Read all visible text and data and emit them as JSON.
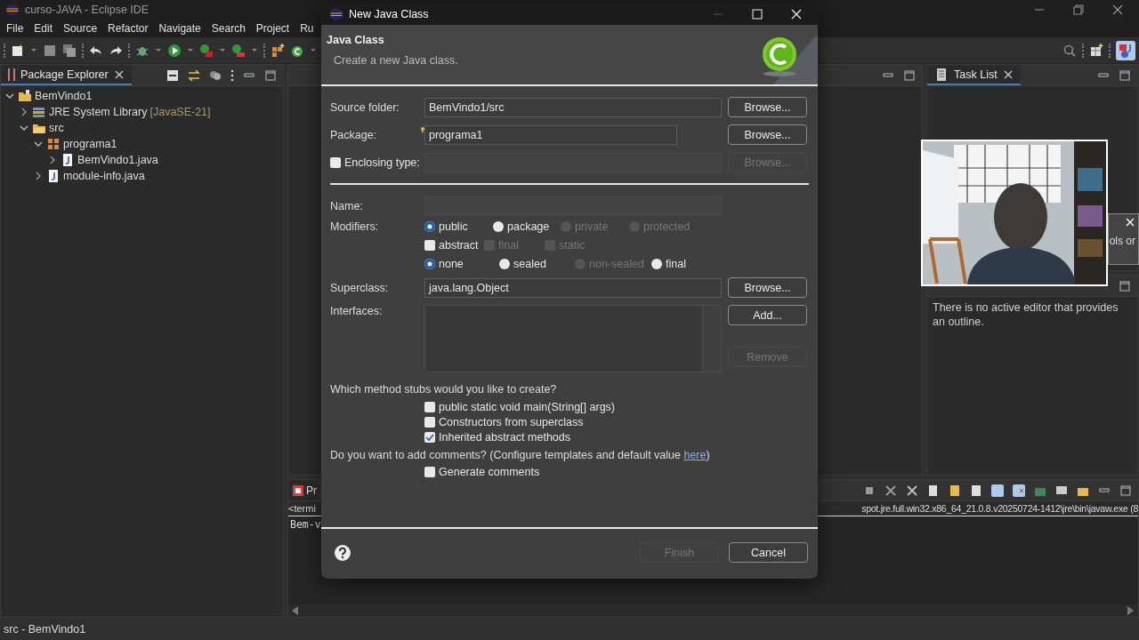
{
  "window": {
    "title": "curso-JAVA - Eclipse IDE"
  },
  "menu": [
    "File",
    "Edit",
    "Source",
    "Refactor",
    "Navigate",
    "Search",
    "Project",
    "Ru"
  ],
  "package_explorer": {
    "title": "Package Explorer",
    "tree": [
      {
        "label": "BemVindo1",
        "kind": "project",
        "expanded": true,
        "children": [
          {
            "label": "JRE System Library",
            "suffix": "[JavaSE-21]",
            "kind": "library",
            "expanded": false
          },
          {
            "label": "src",
            "kind": "folder",
            "expanded": true,
            "children": [
              {
                "label": "programa1",
                "kind": "package",
                "expanded": true,
                "children": [
                  {
                    "label": "BemVindo1.java",
                    "kind": "java",
                    "expanded": false
                  }
                ]
              },
              {
                "label": "module-info.java",
                "kind": "java",
                "expanded": false
              }
            ]
          }
        ]
      }
    ]
  },
  "task_list": {
    "title": "Task List"
  },
  "notification": {
    "text": "ols or"
  },
  "outline": {
    "message": "There is no active editor that provides an outline."
  },
  "console": {
    "tab": "Pr",
    "header_left": "<termi",
    "header_right": "spot.jre.full.win32.x86_64_21.0.8.v20250724-1412\\jre\\bin\\javaw.exe  (8",
    "output": "Bem-v"
  },
  "status_bar": {
    "text": "src - BemVindo1"
  },
  "dialog": {
    "title": "New Java Class",
    "heading": "Java Class",
    "description": "Create a new Java class.",
    "source_folder": {
      "label": "Source folder:",
      "value": "BemVindo1/src",
      "button": "Browse...",
      "button_disabled": false
    },
    "package": {
      "label": "Package:",
      "value": "programa1",
      "button": "Browse...",
      "button_disabled": false
    },
    "enclosing_type": {
      "label": "Enclosing type:",
      "checked": false,
      "button": "Browse...",
      "button_disabled": true
    },
    "name": {
      "label": "Name:"
    },
    "modifiers": {
      "label": "Modifiers:",
      "rows": [
        [
          {
            "kind": "radio",
            "label": "public",
            "selected": true,
            "disabled": false
          },
          {
            "kind": "radio",
            "label": "package",
            "selected": false,
            "disabled": false
          },
          {
            "kind": "radio",
            "label": "private",
            "selected": false,
            "disabled": true
          },
          {
            "kind": "radio",
            "label": "protected",
            "selected": false,
            "disabled": true
          }
        ],
        [
          {
            "kind": "checkbox",
            "label": "abstract",
            "checked": false,
            "disabled": false
          },
          {
            "kind": "checkbox",
            "label": "final",
            "checked": false,
            "disabled": true
          },
          {
            "kind": "checkbox",
            "label": "static",
            "checked": false,
            "disabled": true
          }
        ],
        [
          {
            "kind": "radio",
            "label": "none",
            "selected": true,
            "disabled": false
          },
          {
            "kind": "radio",
            "label": "sealed",
            "selected": false,
            "disabled": false
          },
          {
            "kind": "radio",
            "label": "non-sealed",
            "selected": false,
            "disabled": true
          },
          {
            "kind": "radio",
            "label": "final",
            "selected": false,
            "disabled": false
          }
        ]
      ]
    },
    "superclass": {
      "label": "Superclass:",
      "value": "java.lang.Object",
      "button": "Browse...",
      "button_disabled": false
    },
    "interfaces": {
      "label": "Interfaces:",
      "buttons": [
        {
          "label": "Add...",
          "disabled": false
        },
        {
          "label": "Remove",
          "disabled": true
        }
      ]
    },
    "stubs": {
      "question": "Which method stubs would you like to create?",
      "options": [
        {
          "label": "public static void main(String[] args)",
          "checked": false
        },
        {
          "label": "Constructors from superclass",
          "checked": false
        },
        {
          "label": "Inherited abstract methods",
          "checked": true
        }
      ]
    },
    "comments": {
      "question_before": "Do you want to add comments? (Configure templates and default value ",
      "link": "here",
      "question_after": ")",
      "options": [
        {
          "label": "Generate comments",
          "checked": false
        }
      ]
    },
    "footer_buttons": [
      {
        "label": "Finish",
        "disabled": true
      },
      {
        "label": "Cancel",
        "disabled": false
      }
    ]
  }
}
